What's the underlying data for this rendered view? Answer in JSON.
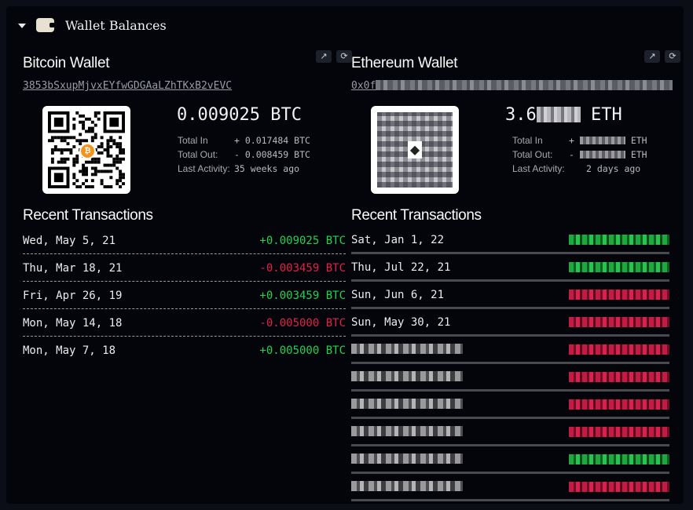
{
  "header": {
    "title": "Wallet Balances",
    "caret_icon": "caret-down-icon",
    "wallet_icon": "wallet-icon"
  },
  "btc": {
    "title": "Bitcoin Wallet",
    "address": "3853bSxupMjvxEYfwGDGAaLZhTKxB2vEVC",
    "balance": "0.009025 BTC",
    "stats": [
      {
        "label": "Total In",
        "value": "+ 0.017484 BTC"
      },
      {
        "label": "Total Out:",
        "value": "- 0.008459 BTC"
      },
      {
        "label": "Last Activity:",
        "value": "35 weeks ago"
      }
    ],
    "recent_title": "Recent Transactions",
    "transactions": [
      {
        "date": "Wed, May 5, 21",
        "amount": "+0.009025 BTC",
        "dir": "in"
      },
      {
        "date": "Thu, Mar 18, 21",
        "amount": "-0.003459 BTC",
        "dir": "out"
      },
      {
        "date": "Fri, Apr 26, 19",
        "amount": "+0.003459 BTC",
        "dir": "in"
      },
      {
        "date": "Mon, May 14, 18",
        "amount": "-0.005000 BTC",
        "dir": "out"
      },
      {
        "date": "Mon, May 7, 18",
        "amount": "+0.005000 BTC",
        "dir": "in"
      }
    ]
  },
  "eth": {
    "title": "Ethereum Wallet",
    "address_prefix": "0x0f",
    "balance_prefix": "3.6",
    "balance_unit": "ETH",
    "stats": [
      {
        "label": "Total In",
        "prefix": "+",
        "unit": "ETH"
      },
      {
        "label": "Total Out:",
        "prefix": "-",
        "unit": "ETH"
      },
      {
        "label": "Last Activity:",
        "value": "2 days ago"
      }
    ],
    "recent_title": "Recent Transactions",
    "transactions": [
      {
        "date": "Sat, Jan 1, 22",
        "dir": "in"
      },
      {
        "date": "Thu, Jul 22, 21",
        "dir": "in"
      },
      {
        "date": "Sun, Jun 6, 21",
        "dir": "out"
      },
      {
        "date": "Sun, May 30, 21",
        "dir": "out"
      },
      {
        "date": "",
        "dir": "out"
      },
      {
        "date": "",
        "dir": "out"
      },
      {
        "date": "",
        "dir": "out"
      },
      {
        "date": "",
        "dir": "out"
      },
      {
        "date": "",
        "dir": "in"
      },
      {
        "date": "",
        "dir": "out"
      }
    ]
  },
  "colors": {
    "positive": "#22d150",
    "negative": "#e0214a",
    "background": "#03050b"
  }
}
